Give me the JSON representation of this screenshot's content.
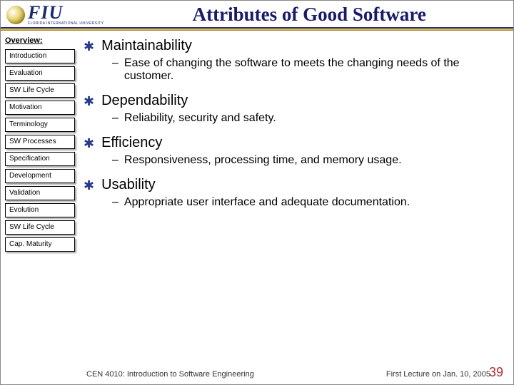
{
  "brand": {
    "main": "FIU",
    "sub": "FLORIDA INTERNATIONAL UNIVERSITY"
  },
  "title": "Attributes of Good Software",
  "sidebar": {
    "heading": "Overview:",
    "items": [
      "Introduction",
      "Evaluation",
      "SW Life Cycle",
      "Motivation",
      "Terminology",
      "SW Processes",
      "Specification",
      "Development",
      "Validation",
      "Evolution",
      "SW Life Cycle",
      "Cap. Maturity"
    ]
  },
  "attributes": [
    {
      "name": "Maintainability",
      "desc": "Ease of changing the software to meets the changing needs of the customer."
    },
    {
      "name": "Dependability",
      "desc": "Reliability, security and safety."
    },
    {
      "name": "Efficiency",
      "desc": "Responsiveness, processing time, and memory usage."
    },
    {
      "name": "Usability",
      "desc": "Appropriate user interface and adequate documentation."
    }
  ],
  "footer": {
    "left": "CEN 4010: Introduction to Software Engineering",
    "right": "First Lecture on Jan. 10, 2005",
    "page": "39"
  }
}
